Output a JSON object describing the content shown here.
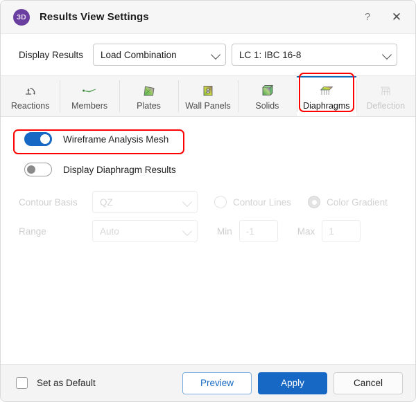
{
  "window": {
    "badge": "3D",
    "title": "Results View Settings",
    "help_label": "?",
    "close_label": "✕",
    "accent_color": "#1668c4",
    "badge_color": "#6b3fa0",
    "highlight_color": "#ff0000"
  },
  "display_results": {
    "label": "Display Results",
    "type_select": {
      "value": "Load Combination"
    },
    "case_select": {
      "value": "LC 1: IBC 16-8"
    }
  },
  "tabs": [
    {
      "label": "Reactions",
      "icon": "reactions-icon",
      "selected": false,
      "disabled": false
    },
    {
      "label": "Members",
      "icon": "members-icon",
      "selected": false,
      "disabled": false
    },
    {
      "label": "Plates",
      "icon": "plates-icon",
      "selected": false,
      "disabled": false
    },
    {
      "label": "Wall Panels",
      "icon": "wall-panels-icon",
      "selected": false,
      "disabled": false
    },
    {
      "label": "Solids",
      "icon": "solids-icon",
      "selected": false,
      "disabled": false
    },
    {
      "label": "Diaphragms",
      "icon": "diaphragms-icon",
      "selected": true,
      "disabled": false
    },
    {
      "label": "Deflection",
      "icon": "deflection-icon",
      "selected": false,
      "disabled": true
    }
  ],
  "options": {
    "wireframe": {
      "label": "Wireframe Analysis Mesh",
      "on": true,
      "highlighted": true
    },
    "display_diaphragm": {
      "label": "Display Diaphragm Results",
      "on": false
    }
  },
  "contour": {
    "basis_label": "Contour Basis",
    "basis_value": "QZ",
    "contour_lines_label": "Contour Lines",
    "contour_lines_selected": false,
    "color_gradient_label": "Color Gradient",
    "color_gradient_selected": true
  },
  "range": {
    "label": "Range",
    "value": "Auto",
    "min_label": "Min",
    "min_value": "-1",
    "max_label": "Max",
    "max_value": "1"
  },
  "footer": {
    "set_default_label": "Set as Default",
    "set_default_checked": false,
    "preview_label": "Preview",
    "apply_label": "Apply",
    "cancel_label": "Cancel"
  }
}
